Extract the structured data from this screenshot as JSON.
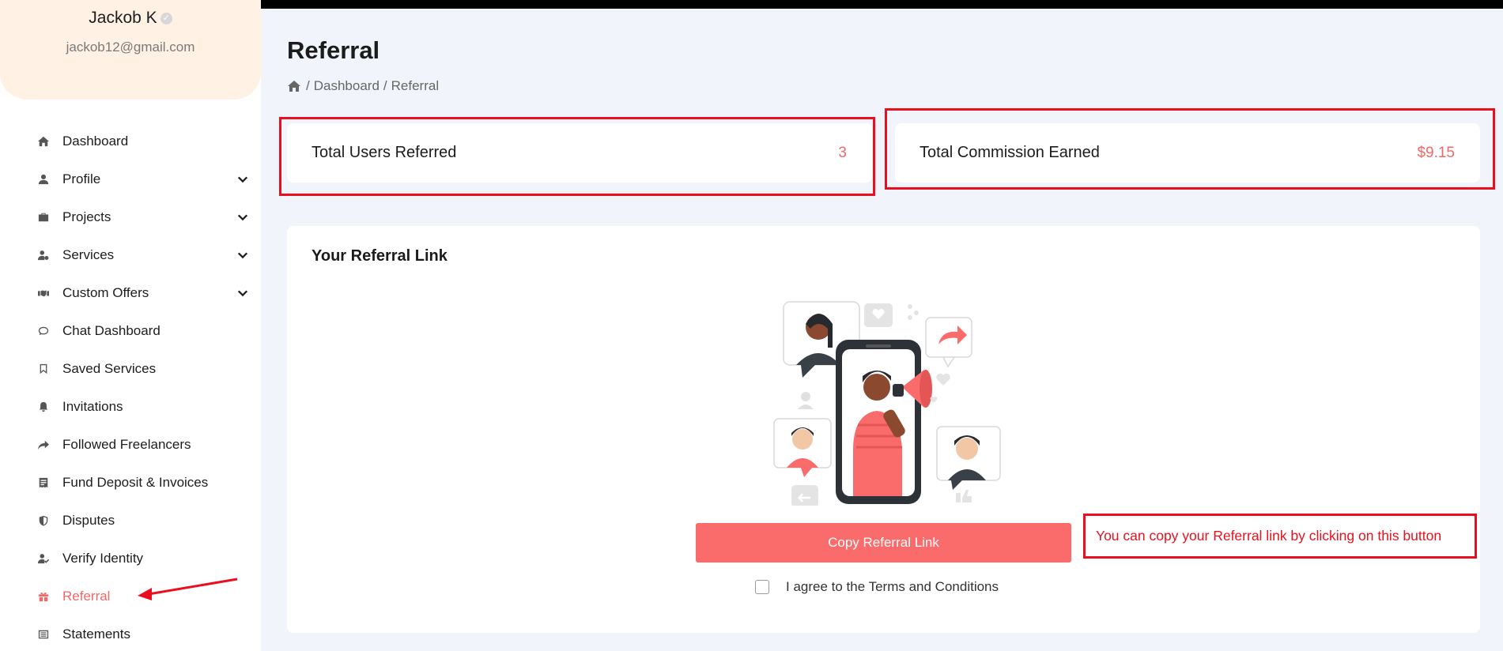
{
  "user": {
    "name": "Jackob K",
    "email": "jackob12@gmail.com"
  },
  "sidebar": {
    "items": [
      {
        "label": "Dashboard",
        "icon": "home-icon",
        "has_submenu": false,
        "active": false
      },
      {
        "label": "Profile",
        "icon": "user-icon",
        "has_submenu": true,
        "active": false
      },
      {
        "label": "Projects",
        "icon": "briefcase-icon",
        "has_submenu": true,
        "active": false
      },
      {
        "label": "Services",
        "icon": "user-gear-icon",
        "has_submenu": true,
        "active": false
      },
      {
        "label": "Custom Offers",
        "icon": "handshake-icon",
        "has_submenu": true,
        "active": false
      },
      {
        "label": "Chat Dashboard",
        "icon": "chat-icon",
        "has_submenu": false,
        "active": false
      },
      {
        "label": "Saved Services",
        "icon": "bookmark-icon",
        "has_submenu": false,
        "active": false
      },
      {
        "label": "Invitations",
        "icon": "bell-icon",
        "has_submenu": false,
        "active": false
      },
      {
        "label": "Followed Freelancers",
        "icon": "share-icon",
        "has_submenu": false,
        "active": false
      },
      {
        "label": "Fund Deposit & Invoices",
        "icon": "receipt-icon",
        "has_submenu": false,
        "active": false
      },
      {
        "label": "Disputes",
        "icon": "shield-icon",
        "has_submenu": false,
        "active": false
      },
      {
        "label": "Verify Identity",
        "icon": "user-check-icon",
        "has_submenu": false,
        "active": false
      },
      {
        "label": "Referral",
        "icon": "gift-icon",
        "has_submenu": false,
        "active": true
      },
      {
        "label": "Statements",
        "icon": "list-icon",
        "has_submenu": false,
        "active": false
      }
    ]
  },
  "page": {
    "title": "Referral",
    "breadcrumb": [
      "Dashboard",
      "Referral"
    ]
  },
  "stats": {
    "users_label": "Total Users Referred",
    "users_value": "3",
    "commission_label": "Total Commission Earned",
    "commission_value": "$9.15"
  },
  "referral": {
    "title": "Your Referral Link",
    "copy_button": "Copy Referral Link",
    "agree_text": "I agree to the Terms and Conditions"
  },
  "annotation": {
    "note": "You can copy your Referral link by clicking on this button"
  },
  "colors": {
    "accent": "#fa6b6b",
    "highlight": "#ea0f1f",
    "background": "#f1f4fb",
    "profile_bg": "#fff1e4"
  }
}
